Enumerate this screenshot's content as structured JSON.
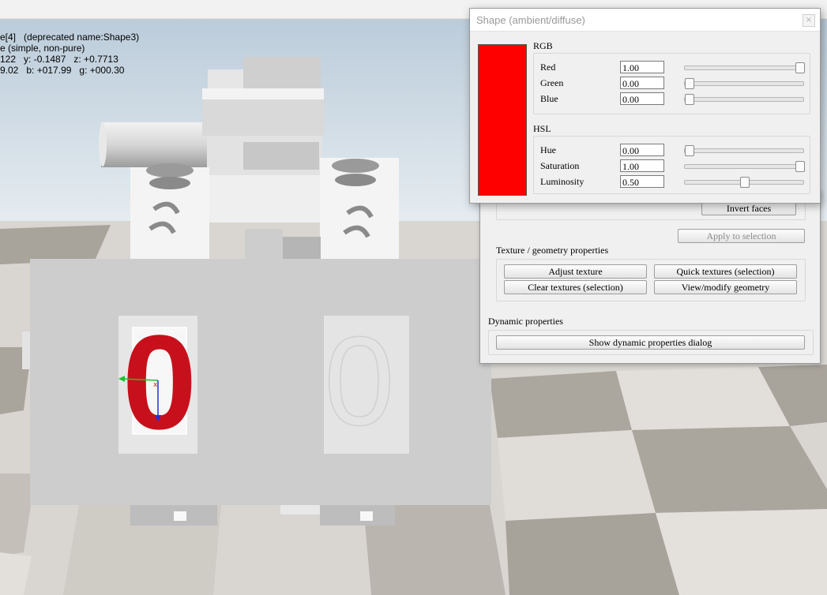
{
  "info_overlay": {
    "line1": "e[4]   (deprecated name:Shape3)",
    "line2": "e (simple, non-pure)",
    "line3": "122   y: -0.1487   z: +0.7713",
    "line4": "9.02   b: +017.99   g: +000.30"
  },
  "color_dialog": {
    "title": "Shape (ambient/diffuse)",
    "close_glyph": "×",
    "preview_color": "#ff0000",
    "rgb_section": {
      "heading": "RGB",
      "rows": [
        {
          "label": "Red",
          "value": "1.00",
          "level": 1.0
        },
        {
          "label": "Green",
          "value": "0.00",
          "level": 0.0
        },
        {
          "label": "Blue",
          "value": "0.00",
          "level": 0.0
        }
      ]
    },
    "hsl_section": {
      "heading": "HSL",
      "rows": [
        {
          "label": "Hue",
          "value": "0.00",
          "level": 0.0
        },
        {
          "label": "Saturation",
          "value": "1.00",
          "level": 1.0
        },
        {
          "label": "Luminosity",
          "value": "0.50",
          "level": 0.5
        }
      ]
    }
  },
  "shape_dialog": {
    "invert_faces_label": "Invert faces",
    "apply_to_selection_label": "Apply to selection",
    "texture_heading": "Texture / geometry properties",
    "adjust_texture_label": "Adjust texture",
    "quick_textures_label": "Quick textures (selection)",
    "clear_textures_label": "Clear textures (selection)",
    "view_geometry_label": "View/modify geometry",
    "dynamic_heading": "Dynamic properties",
    "show_dynamic_label": "Show dynamic properties dialog"
  },
  "scene": {
    "selected_digit": "0",
    "ghost_digit": "0",
    "selected_color": "#c8101c"
  }
}
